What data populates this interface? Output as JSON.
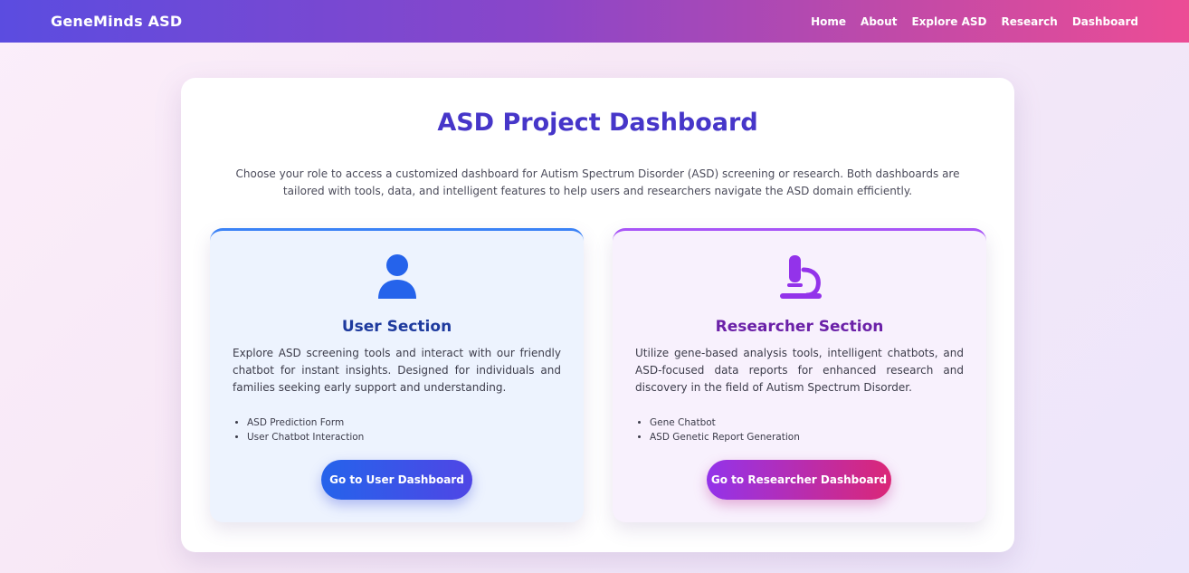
{
  "nav": {
    "brand": "GeneMinds ASD",
    "links": [
      "Home",
      "About",
      "Explore ASD",
      "Research",
      "Dashboard"
    ]
  },
  "main": {
    "title": "ASD Project Dashboard",
    "intro": "Choose your role to access a customized dashboard for Autism Spectrum Disorder (ASD) screening or research. Both dashboards are tailored with tools, data, and intelligent features to help users and researchers navigate the ASD domain efficiently."
  },
  "user_card": {
    "icon": "user-icon",
    "title": "User Section",
    "description": "Explore ASD screening tools and interact with our friendly chatbot for instant insights. Designed for individuals and families seeking early support and understanding.",
    "features": [
      "ASD Prediction Form",
      "User Chatbot Interaction"
    ],
    "button": "Go to User Dashboard",
    "accent": "#3b82f6"
  },
  "researcher_card": {
    "icon": "microscope-icon",
    "title": "Researcher Section",
    "description": "Utilize gene-based analysis tools, intelligent chatbots, and ASD-focused data reports for enhanced research and discovery in the field of Autism Spectrum Disorder.",
    "features": [
      "Gene Chatbot",
      "ASD Genetic Report Generation"
    ],
    "button": "Go to Researcher Dashboard",
    "accent": "#a855f7"
  }
}
